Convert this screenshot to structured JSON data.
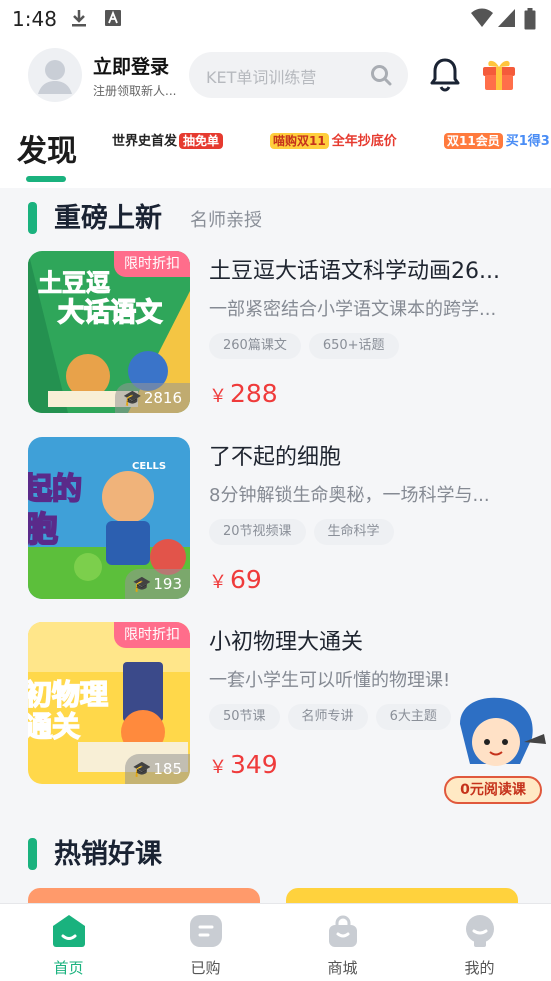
{
  "status_bar": {
    "time": "1:48",
    "icons": [
      "download-icon",
      "a-box-icon",
      "wifi-icon",
      "signal-icon",
      "battery-icon"
    ]
  },
  "header": {
    "login_title": "立即登录",
    "login_subtitle": "注册领取新人...",
    "search_placeholder": "KET单词训练营",
    "icons": [
      "bell-icon",
      "gift-icon",
      "search-icon",
      "avatar-icon"
    ]
  },
  "tabs": {
    "active": "发现",
    "banners": [
      {
        "text": "世界史首发",
        "tag": "抽免单"
      },
      {
        "text": "喵购双11",
        "tag": "全年抄底价"
      },
      {
        "text": "双11会员",
        "tag": "买1得3"
      }
    ]
  },
  "sections": {
    "new": {
      "title": "重磅上新",
      "subtitle": "名师亲授"
    },
    "hot": {
      "title": "热销好课"
    }
  },
  "courses": [
    {
      "title": "土豆逗大话语文科学动画26...",
      "description": "一部紧密结合小学语文课本的跨学...",
      "tags": [
        "260篇课文",
        "650+话题"
      ],
      "currency": "￥",
      "price": "288",
      "badge": "限时折扣",
      "learners": "2816",
      "thumb_text": [
        "土豆逗",
        "大话语文"
      ]
    },
    {
      "title": "了不起的细胞",
      "description": "8分钟解锁生命奥秘，一场科学与...",
      "tags": [
        "20节视频课",
        "生命科学"
      ],
      "currency": "￥",
      "price": "69",
      "badge": "",
      "learners": "193",
      "thumb_text": [
        "起的",
        "胞",
        "CELLS"
      ]
    },
    {
      "title": "小初物理大通关",
      "description": "一套小学生可以听懂的物理课!",
      "tags": [
        "50节课",
        "名师专讲",
        "6大主题"
      ],
      "currency": "￥",
      "price": "349",
      "badge": "限时折扣",
      "learners": "185",
      "thumb_text": [
        "初物理",
        "通关"
      ]
    }
  ],
  "floating_promo": {
    "label": "0元阅读课"
  },
  "bottom_nav": [
    {
      "label": "首页",
      "icon": "home-icon",
      "active": true
    },
    {
      "label": "已购",
      "icon": "purchased-icon",
      "active": false
    },
    {
      "label": "商城",
      "icon": "shop-bag-icon",
      "active": false
    },
    {
      "label": "我的",
      "icon": "profile-icon",
      "active": false
    }
  ],
  "colors": {
    "accent": "#1ab27e",
    "price": "#ef3b3b",
    "badge": "#ff6d8b",
    "inactive_nav": "#9aa0a8"
  }
}
